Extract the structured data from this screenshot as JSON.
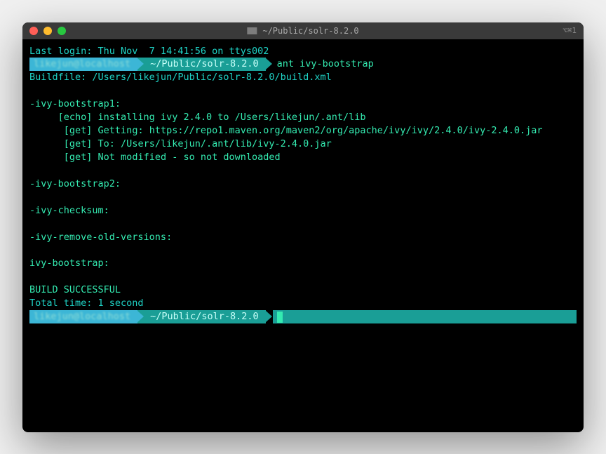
{
  "titlebar": {
    "title": "~/Public/solr-8.2.0",
    "right_indicator": "⌥⌘1"
  },
  "prompt1": {
    "user_host": "likejun@localhost",
    "path": "~/Public/solr-8.2.0",
    "command": "ant ivy-bootstrap"
  },
  "prompt2": {
    "user_host": "likejun@localhost",
    "path": "~/Public/solr-8.2.0"
  },
  "lines": {
    "last_login": "Last login: Thu Nov  7 14:41:56 on ttys002",
    "buildfile": "Buildfile: /Users/likejun/Public/solr-8.2.0/build.xml",
    "target1": "-ivy-bootstrap1:",
    "echo1": "     [echo] installing ivy 2.4.0 to /Users/likejun/.ant/lib",
    "get1": "      [get] Getting: https://repo1.maven.org/maven2/org/apache/ivy/ivy/2.4.0/ivy-2.4.0.jar",
    "get2": "      [get] To: /Users/likejun/.ant/lib/ivy-2.4.0.jar",
    "get3": "      [get] Not modified - so not downloaded",
    "target2": "-ivy-bootstrap2:",
    "target3": "-ivy-checksum:",
    "target4": "-ivy-remove-old-versions:",
    "target5": "ivy-bootstrap:",
    "build_success": "BUILD SUCCESSFUL",
    "total_time": "Total time: 1 second"
  }
}
